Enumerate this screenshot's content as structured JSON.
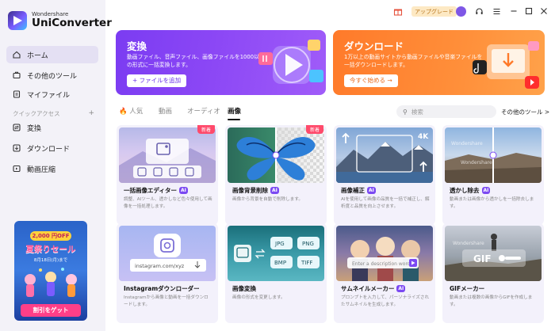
{
  "app": {
    "brand": "Wondershare",
    "name": "UniConverter"
  },
  "topbar": {
    "upgrade_label": "アップグレード"
  },
  "sidebar": {
    "items": [
      {
        "label": "ホーム",
        "icon": "home-icon",
        "active": true
      },
      {
        "label": "その他のツール",
        "icon": "tools-icon",
        "active": false
      },
      {
        "label": "マイファイル",
        "icon": "file-icon",
        "active": false
      }
    ],
    "quick_access_label": "クイックアクセス",
    "quick_access_add": "+",
    "quick_items": [
      {
        "label": "変換",
        "icon": "convert-icon"
      },
      {
        "label": "ダウンロード",
        "icon": "download-icon"
      },
      {
        "label": "動画圧縮",
        "icon": "compress-icon"
      }
    ],
    "promo": {
      "badge": "2,000 円OFF",
      "title": "夏祭りセール",
      "date": "8月18日(月)まで",
      "button": "割引をゲット"
    }
  },
  "banners": {
    "convert": {
      "title": "変換",
      "desc": "動画ファイル、音声ファイル、画像ファイルを1000以上の形式に一括変換します。",
      "button": "+ ファイルを追加",
      "color": "#7b3cf2"
    },
    "download": {
      "title": "ダウンロード",
      "desc": "1万以上の動画サイトから動画ファイルや音楽ファイルを一括ダウンロードします。",
      "button": "今すぐ始める →",
      "color": "#ff7a2a"
    }
  },
  "tabs": {
    "items": [
      "人気",
      "動画",
      "オーディオ",
      "画像"
    ],
    "active": "画像"
  },
  "search": {
    "placeholder": "検索"
  },
  "other_tools_link": "その他のツール >",
  "cards": [
    {
      "title": "一括画像エディター",
      "ai": "AI",
      "new": "新着",
      "desc": "調整、AIツール、透かしなど色々使用して画像を一括処理します。"
    },
    {
      "title": "画像背景削除",
      "ai": "AI",
      "new": "新着",
      "desc": "画像から背景を自動で削除します。"
    },
    {
      "title": "画像補正",
      "ai": "AI",
      "new": "",
      "desc": "AIを使用して画像の品質を一括で補正し、解析度と品質を向上させます。"
    },
    {
      "title": "透かし除去",
      "ai": "AI",
      "new": "",
      "desc": "動画または画像から透かしを一括除去します。"
    },
    {
      "title": "Instagramダウンローダー",
      "ai": "",
      "new": "",
      "desc": "Instagramから画像と動画を一括ダウンロードします。",
      "url": "instagram.com/xyz"
    },
    {
      "title": "画像変換",
      "ai": "",
      "new": "",
      "desc": "画像の形式を変更します。",
      "formats": [
        "JPG",
        "PNG",
        "BMP",
        "TIFF"
      ]
    },
    {
      "title": "サムネイルメーカー",
      "ai": "AI",
      "new": "",
      "desc": "プロンプトを入力して、パーソナライズされたサムネイルを生成します。",
      "prompt": "Enter a description word"
    },
    {
      "title": "GIFメーカー",
      "ai": "",
      "new": "",
      "desc": "動画または複数の画像からGIFを作成します。",
      "gif_label": "GIF"
    }
  ],
  "card_watermark": "Wondershare"
}
